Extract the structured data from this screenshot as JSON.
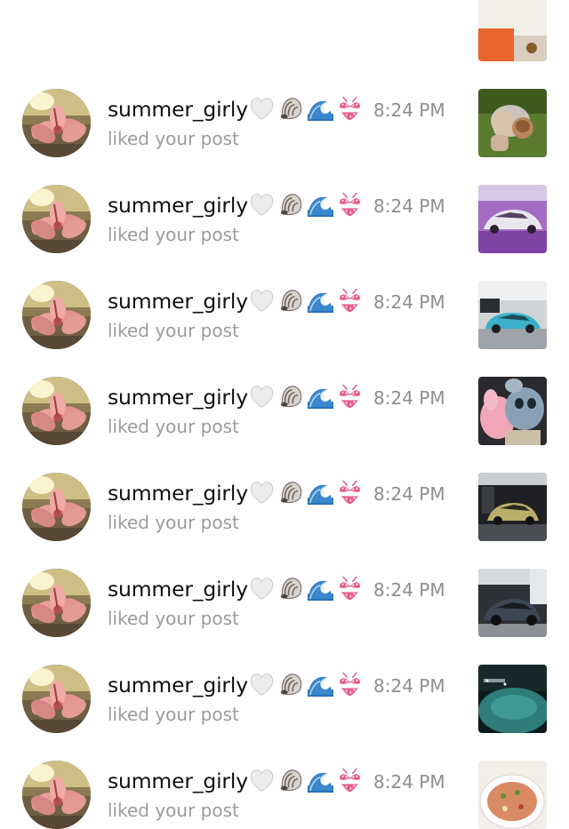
{
  "notifications": [
    {
      "username": "",
      "emojis": [],
      "action": "",
      "time": "",
      "thumbnail": "food-orange"
    },
    {
      "username": "summer_girly",
      "emojis": [
        "white-heart",
        "spiral-shell",
        "water-wave",
        "bikini"
      ],
      "action": "liked your post",
      "time": "8:24 PM",
      "thumbnail": "hands-cup"
    },
    {
      "username": "summer_girly",
      "emojis": [
        "white-heart",
        "spiral-shell",
        "water-wave",
        "bikini"
      ],
      "action": "liked your post",
      "time": "8:24 PM",
      "thumbnail": "purple-supercar"
    },
    {
      "username": "summer_girly",
      "emojis": [
        "white-heart",
        "spiral-shell",
        "water-wave",
        "bikini"
      ],
      "action": "liked your post",
      "time": "8:24 PM",
      "thumbnail": "blue-supercar-garage"
    },
    {
      "username": "summer_girly",
      "emojis": [
        "white-heart",
        "spiral-shell",
        "water-wave",
        "bikini"
      ],
      "action": "liked your post",
      "time": "8:24 PM",
      "thumbnail": "plush-toys"
    },
    {
      "username": "summer_girly",
      "emojis": [
        "white-heart",
        "spiral-shell",
        "water-wave",
        "bikini"
      ],
      "action": "liked your post",
      "time": "8:24 PM",
      "thumbnail": "gold-supercar-garage"
    },
    {
      "username": "summer_girly",
      "emojis": [
        "white-heart",
        "spiral-shell",
        "water-wave",
        "bikini"
      ],
      "action": "liked your post",
      "time": "8:24 PM",
      "thumbnail": "dark-supercar-showroom"
    },
    {
      "username": "summer_girly",
      "emojis": [
        "white-heart",
        "spiral-shell",
        "water-wave",
        "bikini"
      ],
      "action": "liked your post",
      "time": "8:24 PM",
      "thumbnail": "night-pool"
    },
    {
      "username": "summer_girly",
      "emojis": [
        "white-heart",
        "spiral-shell",
        "water-wave",
        "bikini"
      ],
      "action": "liked your post",
      "time": "8:24 PM",
      "thumbnail": "pasta-dish"
    }
  ]
}
